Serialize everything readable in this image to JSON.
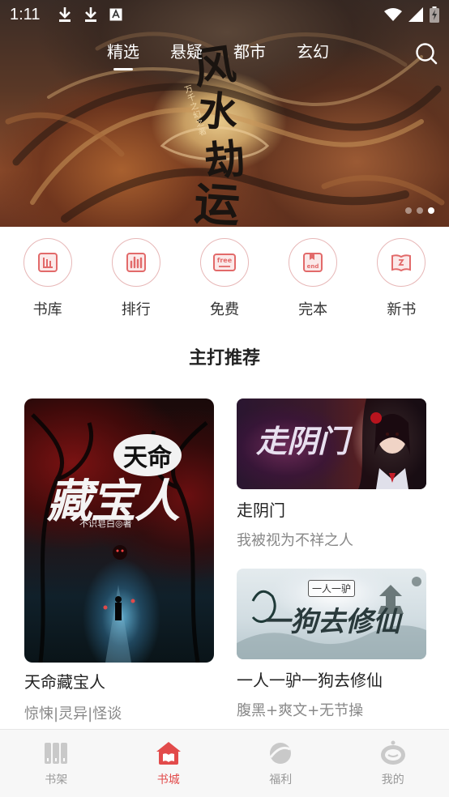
{
  "status_bar": {
    "time": "1:11",
    "icons_left": [
      "download-icon",
      "download-icon",
      "a-icon"
    ],
    "icons_right": [
      "wifi-icon",
      "signal-icon",
      "battery-charging-icon"
    ]
  },
  "top_tabs": [
    {
      "label": "精选",
      "active": true
    },
    {
      "label": "悬疑",
      "active": false
    },
    {
      "label": "都市",
      "active": false
    },
    {
      "label": "玄幻",
      "active": false
    }
  ],
  "banner": {
    "title_chars": [
      "风",
      "水",
      "劫",
      "运"
    ],
    "author": "万千之幻之著",
    "dots_total": 3,
    "active_dot": 3
  },
  "categories": [
    {
      "label": "书库",
      "icon": "library-icon"
    },
    {
      "label": "排行",
      "icon": "ranking-icon"
    },
    {
      "label": "免费",
      "icon": "free-icon"
    },
    {
      "label": "完本",
      "icon": "completed-icon"
    },
    {
      "label": "新书",
      "icon": "new-book-icon"
    }
  ],
  "section": {
    "title": "主打推荐"
  },
  "books": {
    "featured": {
      "name": "天命藏宝人",
      "tags": "惊悚|灵异|怪谈",
      "cover_line1": "天命",
      "cover_line2": "藏宝人",
      "cover_author": "不识皂白◎著"
    },
    "small": [
      {
        "name": "走阴门",
        "tags": "我被视为不祥之人",
        "cover_text": "走阴门"
      },
      {
        "name": "一人一驴一狗去修仙",
        "tags": "腹黑+爽文+无节操",
        "cover_text": "一狗去修仙",
        "cover_sub": "一人一驴"
      }
    ]
  },
  "bottom_nav": [
    {
      "label": "书架",
      "icon": "bookshelf-icon",
      "active": false
    },
    {
      "label": "书城",
      "icon": "bookstore-icon",
      "active": true
    },
    {
      "label": "福利",
      "icon": "welfare-icon",
      "active": false
    },
    {
      "label": "我的",
      "icon": "profile-icon",
      "active": false
    }
  ],
  "colors": {
    "accent": "#e24b4b",
    "category_ring": "#e7b7b7",
    "text_muted": "#888888"
  }
}
